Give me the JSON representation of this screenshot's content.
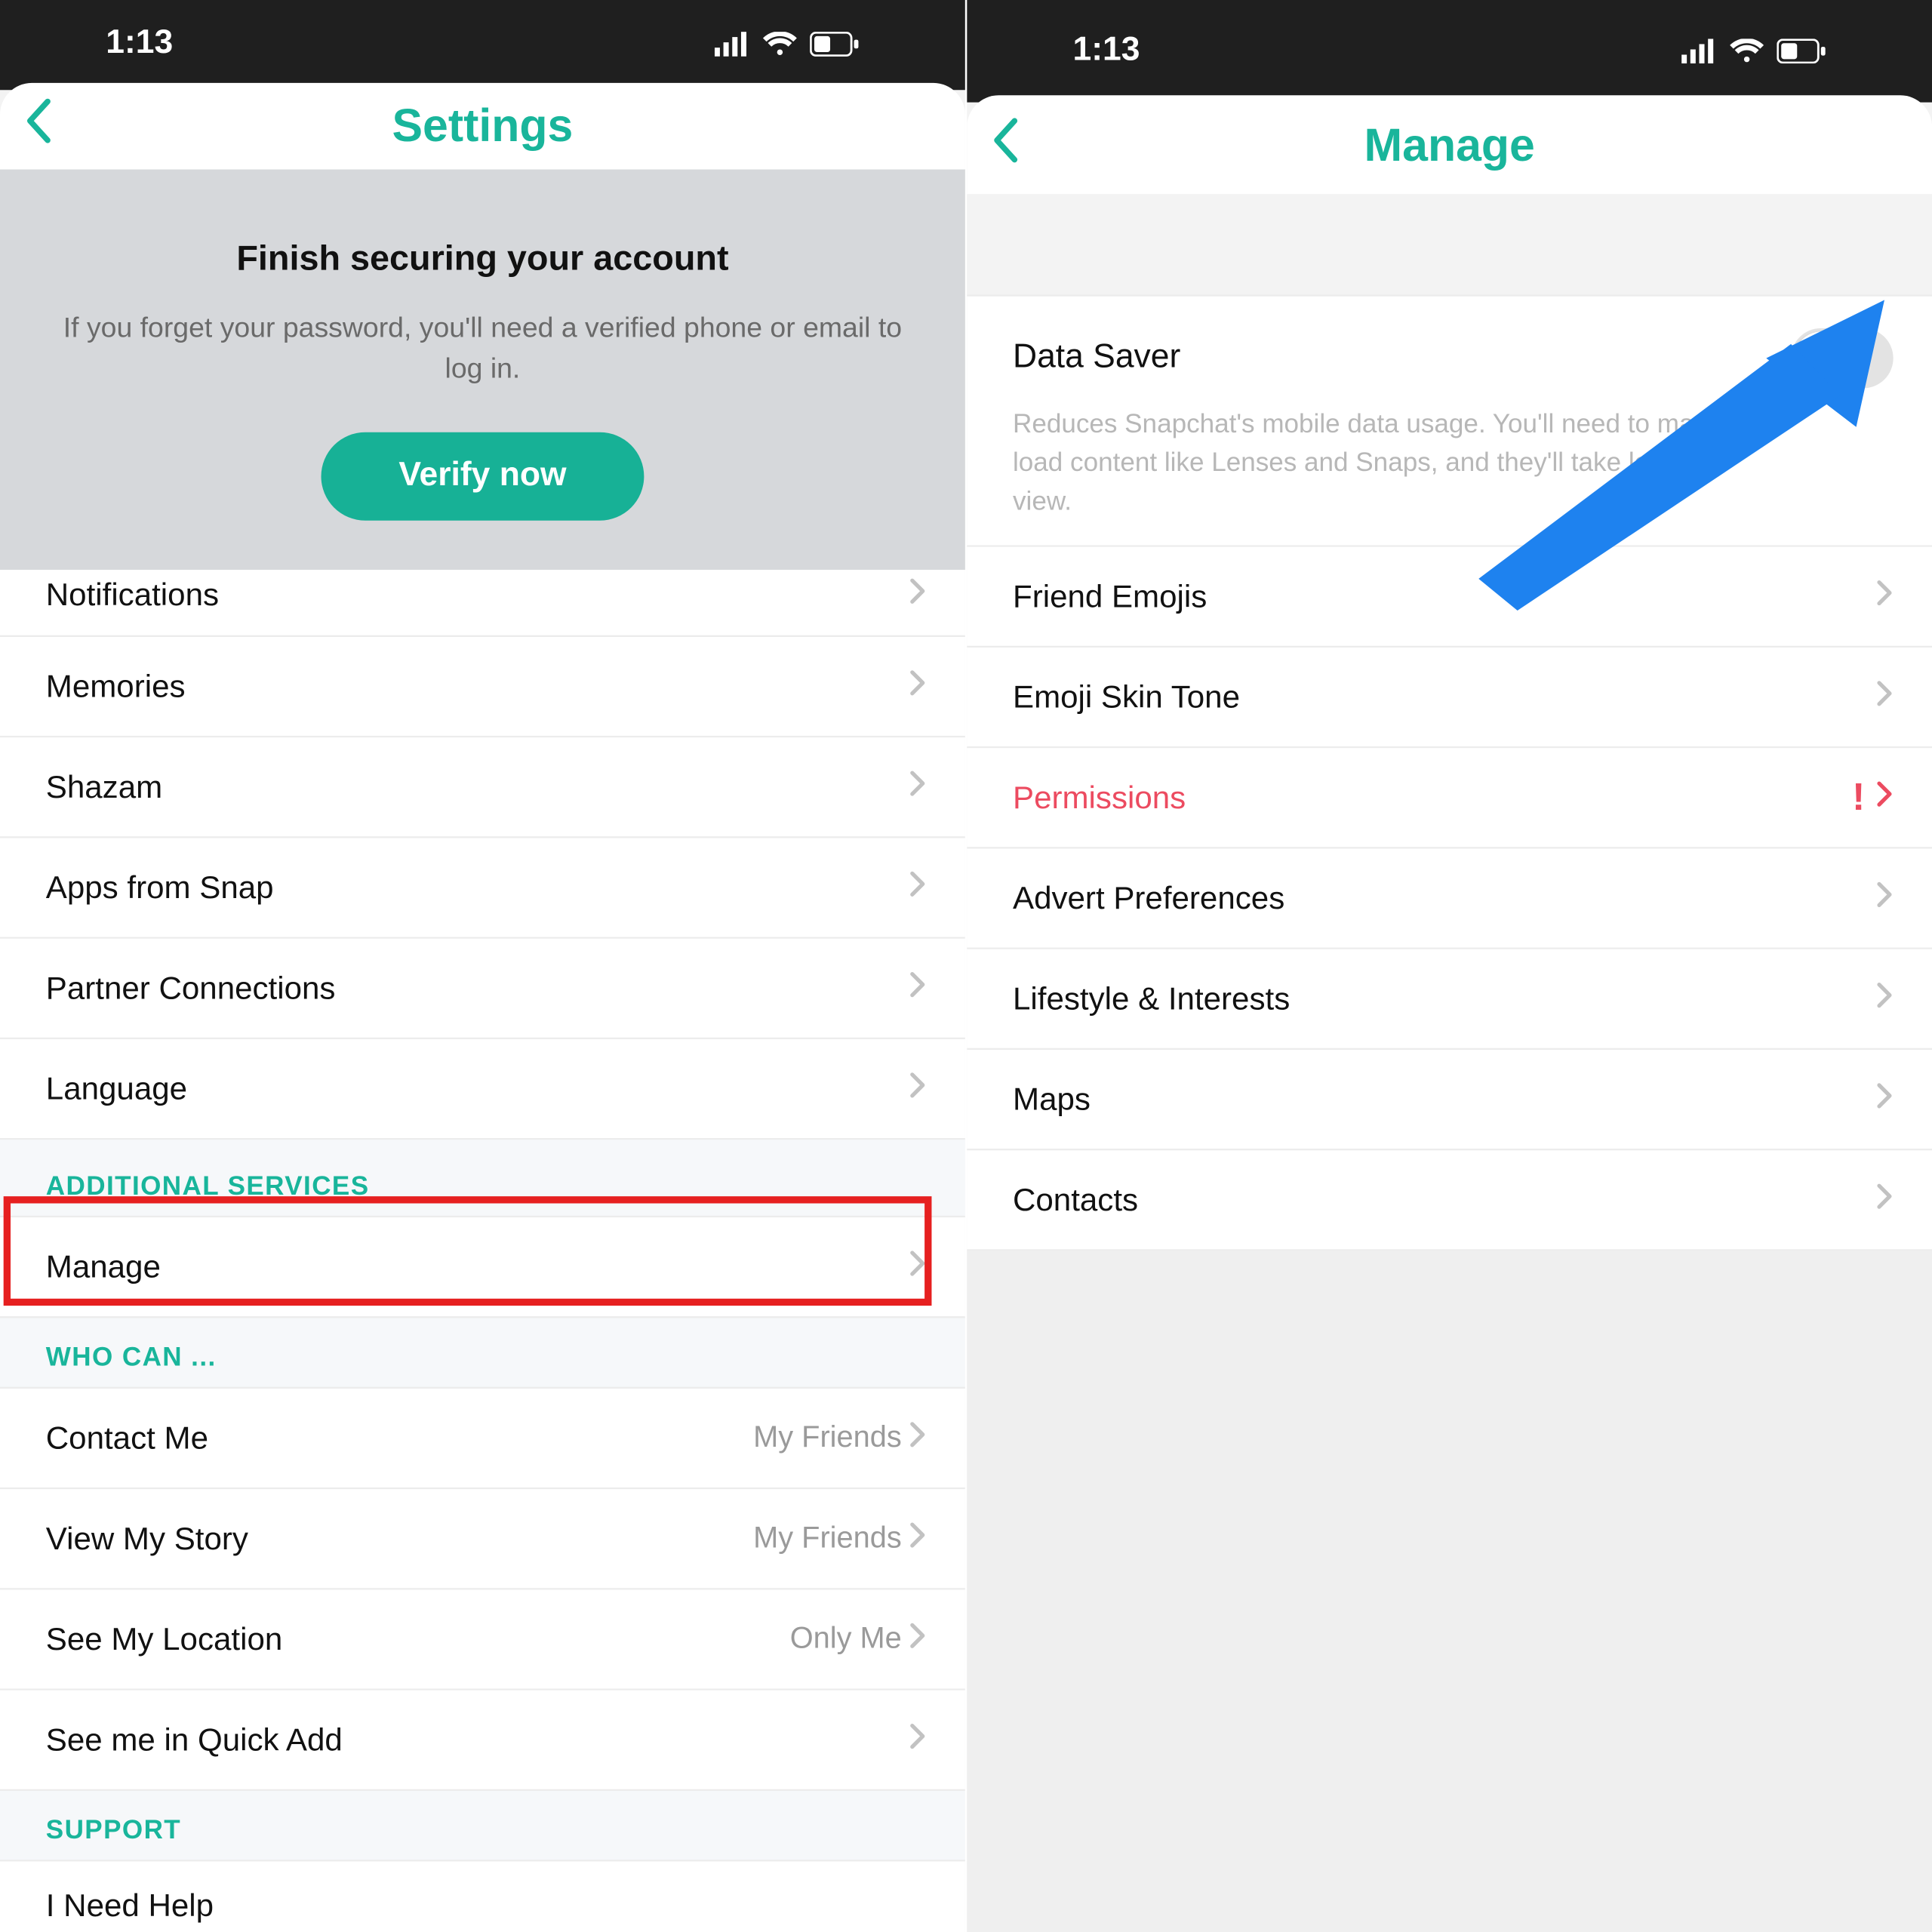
{
  "status": {
    "time": "1:13"
  },
  "left": {
    "title": "Settings",
    "banner": {
      "title": "Finish securing your account",
      "subtitle": "If you forget your password, you'll need a verified phone or email to log in.",
      "button": "Verify now"
    },
    "rows": {
      "notifications": "Notifications",
      "memories": "Memories",
      "shazam": "Shazam",
      "apps_from_snap": "Apps from Snap",
      "partner_connections": "Partner Connections",
      "language": "Language",
      "manage": "Manage",
      "contact_me": "Contact Me",
      "view_my_story": "View My Story",
      "see_my_location": "See My Location",
      "see_me_quick_add": "See me in Quick Add",
      "i_need_help": "I Need Help"
    },
    "values": {
      "contact_me": "My Friends",
      "view_my_story": "My Friends",
      "see_my_location": "Only Me"
    },
    "sections": {
      "additional_services": "ADDITIONAL SERVICES",
      "who_can": "WHO CAN ...",
      "support": "SUPPORT"
    }
  },
  "right": {
    "title": "Manage",
    "datasaver": {
      "title": "Data Saver",
      "desc": "Reduces Snapchat's mobile data usage. You'll need to manually load content like Lenses and Snaps, and they'll take longer to view."
    },
    "rows": {
      "friend_emojis": "Friend Emojis",
      "emoji_skin_tone": "Emoji Skin Tone",
      "permissions": "Permissions",
      "advert_preferences": "Advert Preferences",
      "lifestyle_interests": "Lifestyle & Interests",
      "maps": "Maps",
      "contacts": "Contacts"
    }
  }
}
